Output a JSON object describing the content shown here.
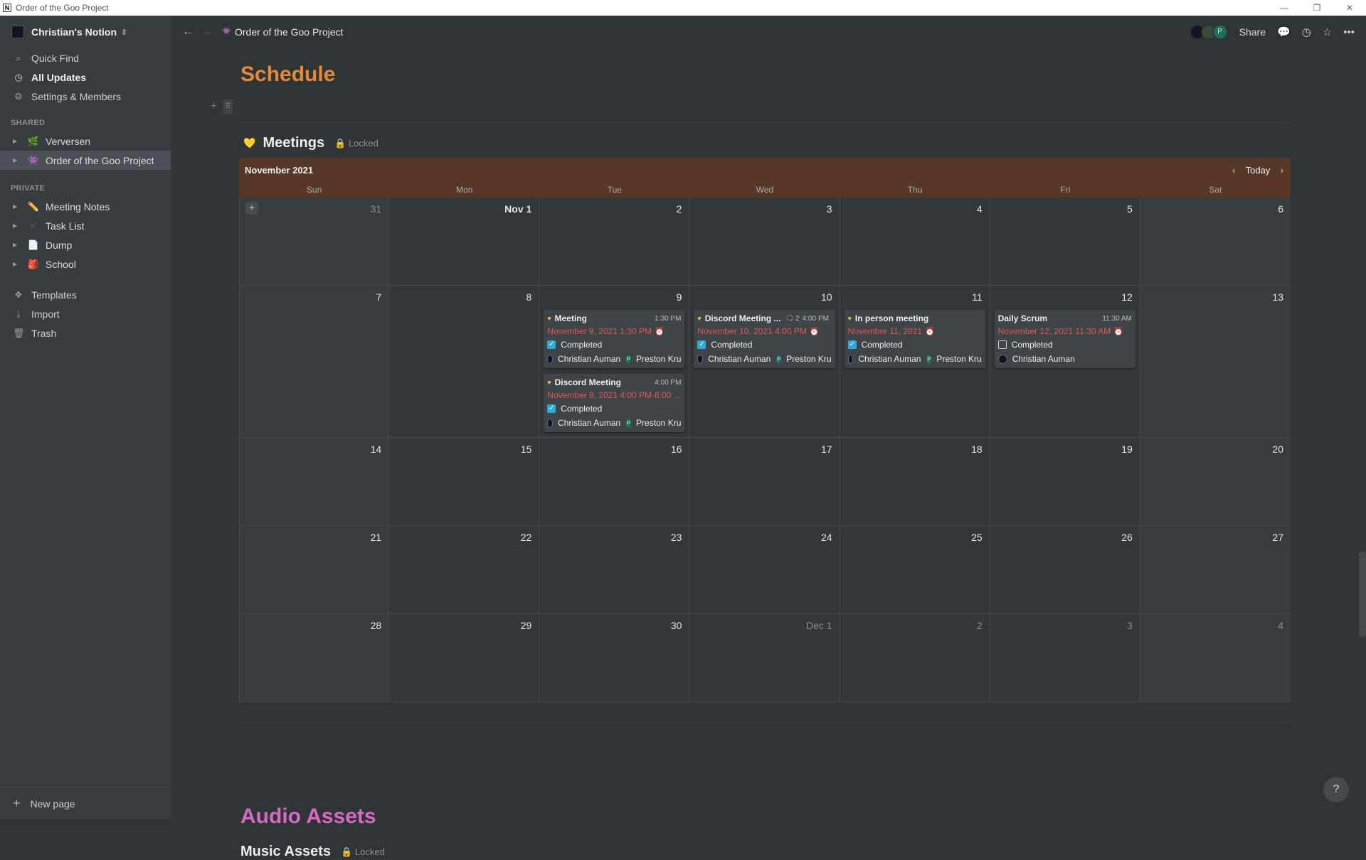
{
  "window": {
    "title": "Order of the Goo Project",
    "app_icon": "N"
  },
  "sidebar": {
    "workspace": "Christian's Notion",
    "nav": [
      {
        "label": "Quick Find",
        "icon": "search-icon"
      },
      {
        "label": "All Updates",
        "icon": "clock-icon"
      },
      {
        "label": "Settings & Members",
        "icon": "gear-icon"
      }
    ],
    "shared_heading": "SHARED",
    "shared": [
      {
        "label": "Verversen",
        "emoji": "🌿"
      },
      {
        "label": "Order of the Goo Project",
        "emoji": "👾"
      }
    ],
    "private_heading": "PRIVATE",
    "private": [
      {
        "label": "Meeting Notes",
        "emoji": "✏️"
      },
      {
        "label": "Task List",
        "emoji": "✔"
      },
      {
        "label": "Dump",
        "emoji": "📄"
      },
      {
        "label": "School",
        "emoji": "🎒"
      }
    ],
    "tools": [
      {
        "label": "Templates",
        "icon": "templates-icon"
      },
      {
        "label": "Import",
        "icon": "import-icon"
      },
      {
        "label": "Trash",
        "icon": "trash-icon"
      }
    ],
    "new_page": "New page"
  },
  "topbar": {
    "breadcrumb": "Order of the Goo Project",
    "share": "Share",
    "avatar_p": "P"
  },
  "page": {
    "heading": "Schedule",
    "db_title": "Meetings",
    "locked": "Locked",
    "audio_heading": "Audio Assets",
    "music_title": "Music Assets",
    "music_locked": "Locked",
    "help": "?"
  },
  "calendar": {
    "month": "November 2021",
    "today": "Today",
    "days_of_week": [
      "Sun",
      "Mon",
      "Tue",
      "Wed",
      "Thu",
      "Fri",
      "Sat"
    ],
    "weeks": [
      [
        "31",
        "Nov 1",
        "2",
        "3",
        "4",
        "5",
        "6"
      ],
      [
        "7",
        "8",
        "9",
        "10",
        "11",
        "12",
        "13"
      ],
      [
        "14",
        "15",
        "16",
        "17",
        "18",
        "19",
        "20"
      ],
      [
        "21",
        "22",
        "23",
        "24",
        "25",
        "26",
        "27"
      ],
      [
        "28",
        "29",
        "30",
        "Dec 1",
        "2",
        "3",
        "4"
      ]
    ],
    "events": [
      {
        "title": "Meeting",
        "time": "1:30 PM",
        "date": "November 9, 2021 1:30 PM",
        "status": "Completed",
        "p1": "Christian Auman",
        "p2": "Preston Kru",
        "p2_initial": "P"
      },
      {
        "title": "Discord Meeting",
        "time": "4:00 PM",
        "date": "November 9, 2021 4:00 PM-6:00 ...",
        "status": "Completed",
        "p1": "Christian Auman",
        "p2": "Preston Kru",
        "p2_initial": "P"
      },
      {
        "title": "Discord Meeting ...",
        "comments": "2",
        "time": "4:00 PM",
        "date": "November 10, 2021 4:00 PM",
        "status": "Completed",
        "p1": "Christian Auman",
        "p2": "Preston Kru",
        "p2_initial": "P"
      },
      {
        "title": "In person meeting",
        "date": "November 11, 2021",
        "status": "Completed",
        "p1": "Christian Auman",
        "p2": "Preston Kru",
        "p2_initial": "P"
      },
      {
        "title": "Daily Scrum",
        "time": "11:30 AM",
        "date": "November 12, 2021 11:30 AM",
        "status": "Completed",
        "p1": "Christian Auman"
      }
    ]
  },
  "colors": {
    "schedule_heading": "#e48839",
    "audio_heading": "#d869c4",
    "calendar_header": "#573828",
    "date_red": "#e0574f",
    "checkbox": "#2eaadc"
  }
}
